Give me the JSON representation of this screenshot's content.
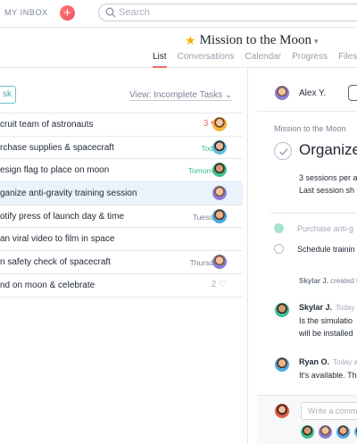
{
  "topbar": {
    "inbox_label": "MY INBOX",
    "plus_label": "+",
    "search_placeholder": "Search"
  },
  "project": {
    "name": "Mission to the Moon",
    "star_icon": "star-icon",
    "star_color": "#f5b400",
    "tabs": [
      {
        "label": "List",
        "active": true
      },
      {
        "label": "Conversations",
        "active": false
      },
      {
        "label": "Calendar",
        "active": false
      },
      {
        "label": "Progress",
        "active": false
      },
      {
        "label": "Files",
        "active": false
      }
    ]
  },
  "list": {
    "add_task_label": "sk",
    "view_label": "View: Incomplete Tasks",
    "tasks": [
      {
        "title": "cruit team of astronauts",
        "due": "",
        "likes": "3",
        "avatar": "a1"
      },
      {
        "title": "rchase supplies & spacecraft",
        "due": "Today",
        "due_color": "green",
        "avatar": "a2"
      },
      {
        "title": "esign flag to place on moon",
        "due": "Tomorrow",
        "due_color": "green",
        "avatar": "a3"
      },
      {
        "title": "ganize anti-gravity training session",
        "due": "",
        "avatar": "a4",
        "selected": true
      },
      {
        "title": "otify press of launch day & time",
        "due": "Tuesday",
        "avatar": "a5"
      },
      {
        "title": "an viral video to film in space",
        "due": "",
        "avatar": ""
      },
      {
        "title": "n safety check of spacecraft",
        "due": "Thursday",
        "avatar": "a4"
      },
      {
        "title": "nd on moon & celebrate",
        "due": "",
        "likes": "2",
        "avatar": ""
      }
    ]
  },
  "detail": {
    "assignee_name": "Alex Y.",
    "breadcrumb": "Mission to the Moon",
    "title": "Organize",
    "description_line1": "3 sessions per a",
    "description_line2": "Last session sh",
    "subtasks": [
      {
        "label": "Purchase anti-g",
        "done": true
      },
      {
        "label": "Schedule trainin",
        "done": false
      }
    ],
    "created_by": "Skylar J.",
    "created_text": " created t",
    "comments": [
      {
        "author": "Skylar J.",
        "time": "Today",
        "line1": "Is the simulatio",
        "line2": "will be installed",
        "avatar": "a3"
      },
      {
        "author": "Ryan O.",
        "time": "Today a",
        "line1": "It's available. Th",
        "line2": "",
        "avatar": "a5"
      }
    ],
    "comment_placeholder": "Write a comm"
  }
}
